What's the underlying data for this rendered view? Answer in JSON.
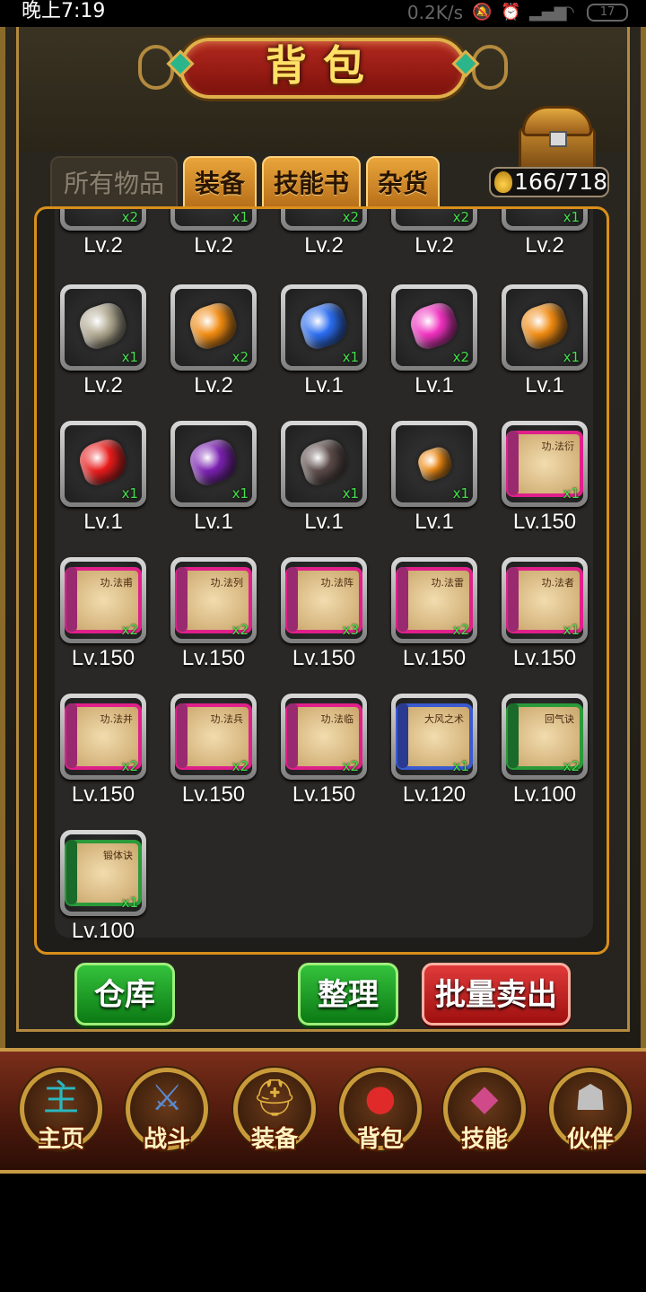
{
  "status_bar": {
    "time": "晚上7:19",
    "net_speed": "0.2K/s",
    "battery": "17"
  },
  "header": {
    "title": "背包"
  },
  "capacity": {
    "text": "166/718"
  },
  "tabs": [
    {
      "label": "所有物品",
      "active": true
    },
    {
      "label": "装备",
      "active": false
    },
    {
      "label": "技能书",
      "active": false
    },
    {
      "label": "杂货",
      "active": false
    }
  ],
  "items": [
    {
      "kind": "partial",
      "level": "Lv.2",
      "qty": "x2",
      "color": "#e0802a"
    },
    {
      "kind": "partial",
      "level": "Lv.2",
      "qty": "x1",
      "color": "#8a3ac0"
    },
    {
      "kind": "partial",
      "level": "Lv.2",
      "qty": "x2",
      "color": "#a040d0"
    },
    {
      "kind": "partial",
      "level": "Lv.2",
      "qty": "x2",
      "color": "#c0a040"
    },
    {
      "kind": "partial",
      "level": "Lv.2",
      "qty": "x1",
      "color": "#e04040"
    },
    {
      "kind": "gem",
      "level": "Lv.2",
      "qty": "x1",
      "color": "#b0a890"
    },
    {
      "kind": "gem",
      "level": "Lv.2",
      "qty": "x2",
      "color": "#f08a10"
    },
    {
      "kind": "gem",
      "level": "Lv.1",
      "qty": "x1",
      "color": "#2a6cf0"
    },
    {
      "kind": "gem",
      "level": "Lv.1",
      "qty": "x2",
      "color": "#f030c0"
    },
    {
      "kind": "gem",
      "level": "Lv.1",
      "qty": "x1",
      "color": "#f08a10"
    },
    {
      "kind": "gem",
      "level": "Lv.1",
      "qty": "x1",
      "color": "#e81a1a"
    },
    {
      "kind": "gem",
      "level": "Lv.1",
      "qty": "x1",
      "color": "#7a20b0"
    },
    {
      "kind": "gem",
      "level": "Lv.1",
      "qty": "x1",
      "color": "#5a4a48"
    },
    {
      "kind": "gem-small",
      "level": "Lv.1",
      "qty": "x1",
      "color": "#f08a10"
    },
    {
      "kind": "scroll",
      "level": "Lv.150",
      "qty": "x1",
      "color": "#e0208a",
      "rod": "#9a2a70",
      "text": "功.法衍"
    },
    {
      "kind": "scroll",
      "level": "Lv.150",
      "qty": "x2",
      "color": "#e0208a",
      "rod": "#9a2a70",
      "text": "功.法甫"
    },
    {
      "kind": "scroll",
      "level": "Lv.150",
      "qty": "x2",
      "color": "#e0208a",
      "rod": "#9a2a70",
      "text": "功.法列"
    },
    {
      "kind": "scroll",
      "level": "Lv.150",
      "qty": "x3",
      "color": "#e0208a",
      "rod": "#9a2a70",
      "text": "功.法阵"
    },
    {
      "kind": "scroll",
      "level": "Lv.150",
      "qty": "x2",
      "color": "#e0208a",
      "rod": "#9a2a70",
      "text": "功.法雷"
    },
    {
      "kind": "scroll",
      "level": "Lv.150",
      "qty": "x1",
      "color": "#e0208a",
      "rod": "#9a2a70",
      "text": "功.法者"
    },
    {
      "kind": "scroll",
      "level": "Lv.150",
      "qty": "x2",
      "color": "#e0208a",
      "rod": "#9a2a70",
      "text": "功.法并"
    },
    {
      "kind": "scroll",
      "level": "Lv.150",
      "qty": "x2",
      "color": "#e0208a",
      "rod": "#9a2a70",
      "text": "功.法兵"
    },
    {
      "kind": "scroll",
      "level": "Lv.150",
      "qty": "x2",
      "color": "#e0208a",
      "rod": "#9a2a70",
      "text": "功.法临"
    },
    {
      "kind": "scroll",
      "level": "Lv.120",
      "qty": "x1",
      "color": "#3a5ad0",
      "rod": "#2a3a90",
      "text": "大风之术"
    },
    {
      "kind": "scroll",
      "level": "Lv.100",
      "qty": "x2",
      "color": "#2a9a3a",
      "rod": "#1a6a2a",
      "text": "回气诀"
    },
    {
      "kind": "scroll",
      "level": "Lv.100",
      "qty": "x1",
      "color": "#2a9a3a",
      "rod": "#1a6a2a",
      "text": "锻体诀"
    }
  ],
  "buttons": {
    "warehouse": "仓库",
    "sort": "整理",
    "bulk_sell": "批量卖出"
  },
  "nav": [
    {
      "label": "主页",
      "icon": "home-icon",
      "glyph": "主",
      "color": "#2ab8c0"
    },
    {
      "label": "战斗",
      "icon": "battle-icon",
      "glyph": "⚔",
      "color": "#5a8ad0"
    },
    {
      "label": "装备",
      "icon": "equipment-icon",
      "glyph": "⛑",
      "color": "#e0b040"
    },
    {
      "label": "背包",
      "icon": "bag-icon",
      "glyph": "●",
      "color": "#e02a2a"
    },
    {
      "label": "技能",
      "icon": "skill-book-icon",
      "glyph": "◆",
      "color": "#d04a8a"
    },
    {
      "label": "伙伴",
      "icon": "partner-icon",
      "glyph": "☗",
      "color": "#c0c0c0"
    }
  ]
}
